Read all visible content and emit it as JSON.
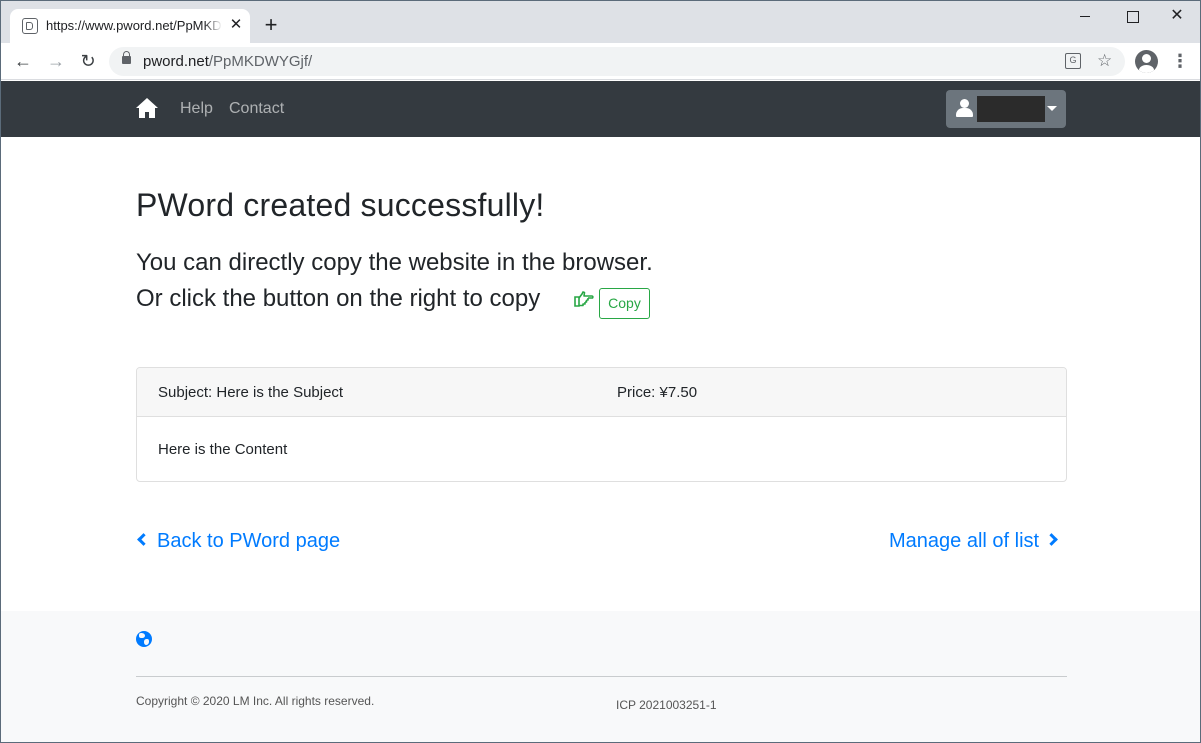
{
  "browser": {
    "tab_title": "https://www.pword.net/PpMKDWYGjf/",
    "tab_close": "✕",
    "new_tab": "+",
    "url_host": "pword.net",
    "url_path": "/PpMKDWYGjf/",
    "translate_glyph": "G",
    "star_glyph": "☆",
    "menu_glyph": "⋮",
    "close_glyph": "✕",
    "back_glyph": "←",
    "forward_glyph": "→",
    "reload_glyph": "↻"
  },
  "navbar": {
    "help": "Help",
    "contact": "Contact",
    "bg_color": "#343a40"
  },
  "main": {
    "title": "PWord created successfully!",
    "line1": "You can directly copy the website in the browser.",
    "line2": "Or click the button on the right to copy",
    "copy_button": "Copy",
    "accent_green": "#28a745"
  },
  "card": {
    "subject": "Subject: Here is the Subject",
    "price": "Price: ¥7.50",
    "content": "Here is the Content"
  },
  "links": {
    "back": "Back to PWord page",
    "manage": "Manage all of list",
    "color": "#007bff"
  },
  "footer": {
    "copyright": "Copyright © 2020 LM Inc. All rights reserved.",
    "icp": "ICP 2021003251-1"
  }
}
